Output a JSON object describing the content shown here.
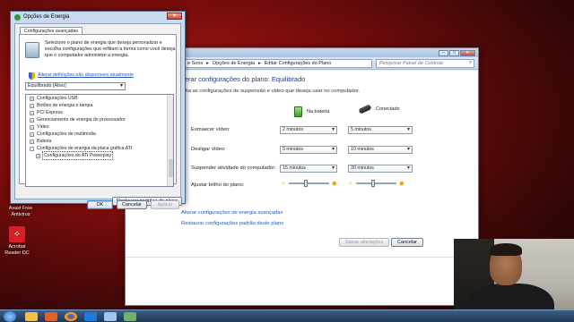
{
  "desktop": {
    "icons": [
      {
        "label": "Avast Free Antivirus",
        "color": "#ff7a1a"
      },
      {
        "label": "Acrobat Reader DC",
        "color": "#d81f26"
      }
    ]
  },
  "control_panel": {
    "breadcrumb": [
      "e Sons",
      "▸",
      "Opções de Energia",
      "▸",
      "Editar Configurações do Plano"
    ],
    "search_placeholder": "Pesquisar Painel de Controle",
    "title": "lterar configurações do plano: Equilibrado",
    "subtitle": "olha as configurações de suspensão e vídeo que deseja usar no computador.",
    "columns": {
      "battery": "Na bateria",
      "plugged": "Conectado"
    },
    "rows": [
      {
        "label": "Esmaecer vídeo:",
        "battery": "2 minutos",
        "plugged": "5 minutos"
      },
      {
        "label": "Desligar vídeo:",
        "battery": "5 minutos",
        "plugged": "10 minutos"
      },
      {
        "label": "Suspender atividade do computador:",
        "battery": "15 minutos",
        "plugged": "30 minutos"
      }
    ],
    "brightness_label": "Ajustar brilho do plano:",
    "brightness": {
      "battery": 0.45,
      "plugged": 0.45
    },
    "links": {
      "advanced": "Alterar configurações de energia avançadas",
      "restore": "Restaurar configurações padrão deste plano"
    },
    "buttons": {
      "save": "Salvar alterações",
      "cancel": "Cancelar"
    },
    "caption_buttons": {
      "min": "–",
      "max": "□",
      "close": "✕"
    }
  },
  "dialog": {
    "title": "Opções de Energia",
    "close": "✕",
    "tab": "Configurações avançadas",
    "description": "Selecione o plano de energia que deseja personalizar e escolha configurações que reflitam a forma como você deseja que o computador administre a energia.",
    "change_link": "Alterar definições não disponíveis atualmente",
    "plan": "Equilibrado [Ativo]",
    "tree": [
      {
        "label": "Configurações USB",
        "pm": "+",
        "child": false
      },
      {
        "label": "Botões de energia e tampa",
        "pm": "+",
        "child": false
      },
      {
        "label": "PCI Express",
        "pm": "+",
        "child": false
      },
      {
        "label": "Gerenciamento de energia do processador",
        "pm": "+",
        "child": false
      },
      {
        "label": "Vídeo",
        "pm": "+",
        "child": false
      },
      {
        "label": "Configurações de multimídia",
        "pm": "+",
        "child": false
      },
      {
        "label": "Bateria",
        "pm": "+",
        "child": false
      },
      {
        "label": "Configurações de energia da placa gráfica ATI",
        "pm": "−",
        "child": false
      },
      {
        "label": "Configurações do ATI Powerplay",
        "pm": "+",
        "child": true
      }
    ],
    "restore_button": "Restaurar padrões do plano",
    "buttons": {
      "ok": "OK",
      "cancel": "Cancelar",
      "apply": "Aplicar"
    }
  },
  "colors": {
    "link": "#2458b8",
    "title": "#1e3b8a"
  }
}
